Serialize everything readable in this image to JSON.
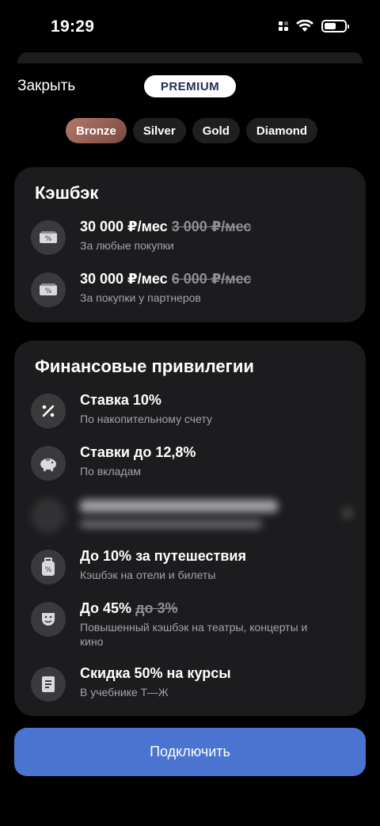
{
  "status": {
    "time": "19:29"
  },
  "header": {
    "close_label": "Закрыть",
    "badge": "PREMIUM"
  },
  "tiers": [
    {
      "label": "Bronze",
      "active": true
    },
    {
      "label": "Silver",
      "active": false
    },
    {
      "label": "Gold",
      "active": false
    },
    {
      "label": "Diamond",
      "active": false
    }
  ],
  "cashback": {
    "title": "Кэшбэк",
    "items": [
      {
        "title": "30 000 ₽/мес",
        "old": "3 000 ₽/мес",
        "sub": "За любые покупки",
        "icon": "ticket-icon"
      },
      {
        "title": "30 000 ₽/мес",
        "old": "6 000 ₽/мес",
        "sub": "За покупки у партнеров",
        "icon": "ticket-icon"
      }
    ]
  },
  "privileges": {
    "title": "Финансовые привилегии",
    "items": [
      {
        "title": "Ставка 10%",
        "old": "",
        "sub": "По накопительному счету",
        "icon": "percent-icon"
      },
      {
        "title": "Ставки до 12,8%",
        "old": "",
        "sub": "По вкладам",
        "icon": "piggy-bank-icon"
      },
      {
        "title": "",
        "old": "",
        "sub": "",
        "icon": "transfer-icon",
        "blurred": true
      },
      {
        "title": "До 10% за путешествия",
        "old": "",
        "sub": "Кэшбэк на отели и билеты",
        "icon": "luggage-icon"
      },
      {
        "title": "До 45%",
        "old": "до 3%",
        "sub": "Повышенный кэшбэк на театры, концерты и кино",
        "icon": "theater-mask-icon"
      },
      {
        "title": "Скидка 50% на курсы",
        "old": "",
        "sub": "В учебнике Т—Ж",
        "icon": "book-icon"
      }
    ]
  },
  "cta": {
    "label": "Подключить"
  }
}
